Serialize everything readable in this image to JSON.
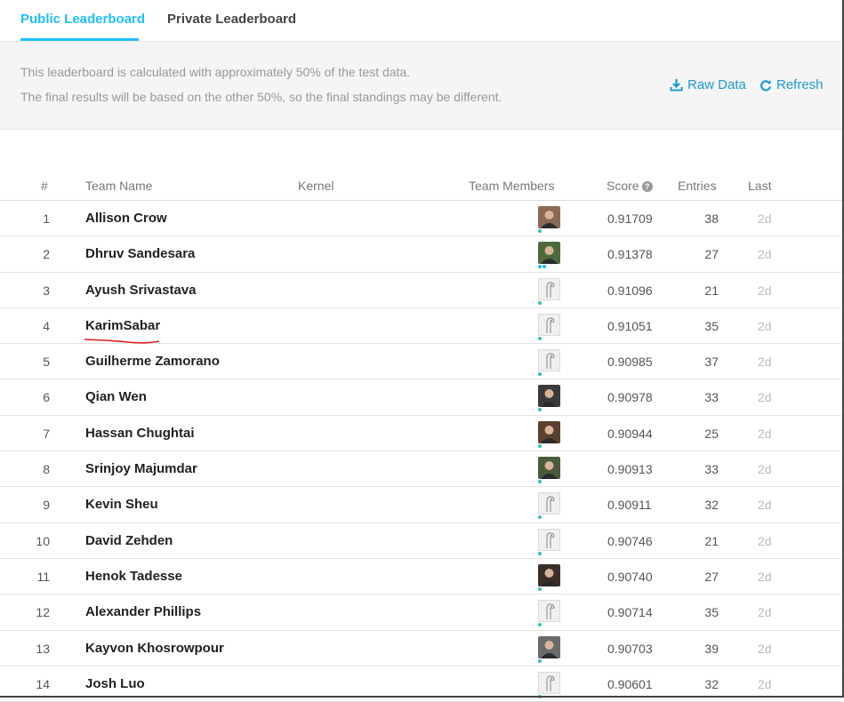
{
  "tabs": {
    "public": "Public Leaderboard",
    "private": "Private Leaderboard"
  },
  "banner": {
    "note_line1": "This leaderboard is calculated with approximately 50% of the test data.",
    "note_line2": "The final results will be based on the other 50%, so the final standings may be different.",
    "raw_data": "Raw Data",
    "refresh": "Refresh"
  },
  "columns": {
    "rank": "#",
    "team_name": "Team Name",
    "kernel": "Kernel",
    "team_members": "Team Members",
    "score": "Score",
    "entries": "Entries",
    "last": "Last"
  },
  "colors": {
    "accent": "#20beff",
    "link": "#1a9bd7",
    "annotation": "#e02020"
  },
  "rows": [
    {
      "rank": "1",
      "name": "Allison Crow",
      "score": "0.91709",
      "entries": "38",
      "last": "2d",
      "avatar": "photo",
      "avatar_bg": "#8b6a55",
      "dots": [
        "teal"
      ]
    },
    {
      "rank": "2",
      "name": "Dhruv Sandesara",
      "score": "0.91378",
      "entries": "27",
      "last": "2d",
      "avatar": "photo",
      "avatar_bg": "#4d6b3a",
      "dots": [
        "blue",
        "blue"
      ]
    },
    {
      "rank": "3",
      "name": "Ayush Srivastava",
      "score": "0.91096",
      "entries": "21",
      "last": "2d",
      "avatar": "generic",
      "dots": [
        "teal"
      ]
    },
    {
      "rank": "4",
      "name": "KarimSabar",
      "score": "0.91051",
      "entries": "35",
      "last": "2d",
      "avatar": "generic",
      "dots": [
        "teal"
      ],
      "underlined": true
    },
    {
      "rank": "5",
      "name": "Guilherme Zamorano",
      "score": "0.90985",
      "entries": "37",
      "last": "2d",
      "avatar": "generic",
      "dots": [
        "teal"
      ]
    },
    {
      "rank": "6",
      "name": "Qian Wen",
      "score": "0.90978",
      "entries": "33",
      "last": "2d",
      "avatar": "photo",
      "avatar_bg": "#3a3a3a",
      "dots": [
        "teal"
      ]
    },
    {
      "rank": "7",
      "name": "Hassan Chughtai",
      "score": "0.90944",
      "entries": "25",
      "last": "2d",
      "avatar": "photo",
      "avatar_bg": "#5a4030",
      "dots": [
        "teal"
      ]
    },
    {
      "rank": "8",
      "name": "Srinjoy Majumdar",
      "score": "0.90913",
      "entries": "33",
      "last": "2d",
      "avatar": "photo",
      "avatar_bg": "#4a5a3a",
      "dots": [
        "teal"
      ]
    },
    {
      "rank": "9",
      "name": "Kevin Sheu",
      "score": "0.90911",
      "entries": "32",
      "last": "2d",
      "avatar": "generic",
      "dots": [
        "teal"
      ]
    },
    {
      "rank": "10",
      "name": "David Zehden",
      "score": "0.90746",
      "entries": "21",
      "last": "2d",
      "avatar": "generic",
      "dots": [
        "teal"
      ]
    },
    {
      "rank": "11",
      "name": "Henok Tadesse",
      "score": "0.90740",
      "entries": "27",
      "last": "2d",
      "avatar": "photo",
      "avatar_bg": "#3b2e28",
      "dots": [
        "teal"
      ]
    },
    {
      "rank": "12",
      "name": "Alexander Phillips",
      "score": "0.90714",
      "entries": "35",
      "last": "2d",
      "avatar": "generic",
      "dots": [
        "teal"
      ]
    },
    {
      "rank": "13",
      "name": "Kayvon Khosrowpour",
      "score": "0.90703",
      "entries": "39",
      "last": "2d",
      "avatar": "photo",
      "avatar_bg": "#6a6a6a",
      "dots": [
        "teal"
      ]
    },
    {
      "rank": "14",
      "name": "Josh Luo",
      "score": "0.90601",
      "entries": "32",
      "last": "2d",
      "avatar": "generic",
      "dots": [
        "teal"
      ]
    }
  ]
}
